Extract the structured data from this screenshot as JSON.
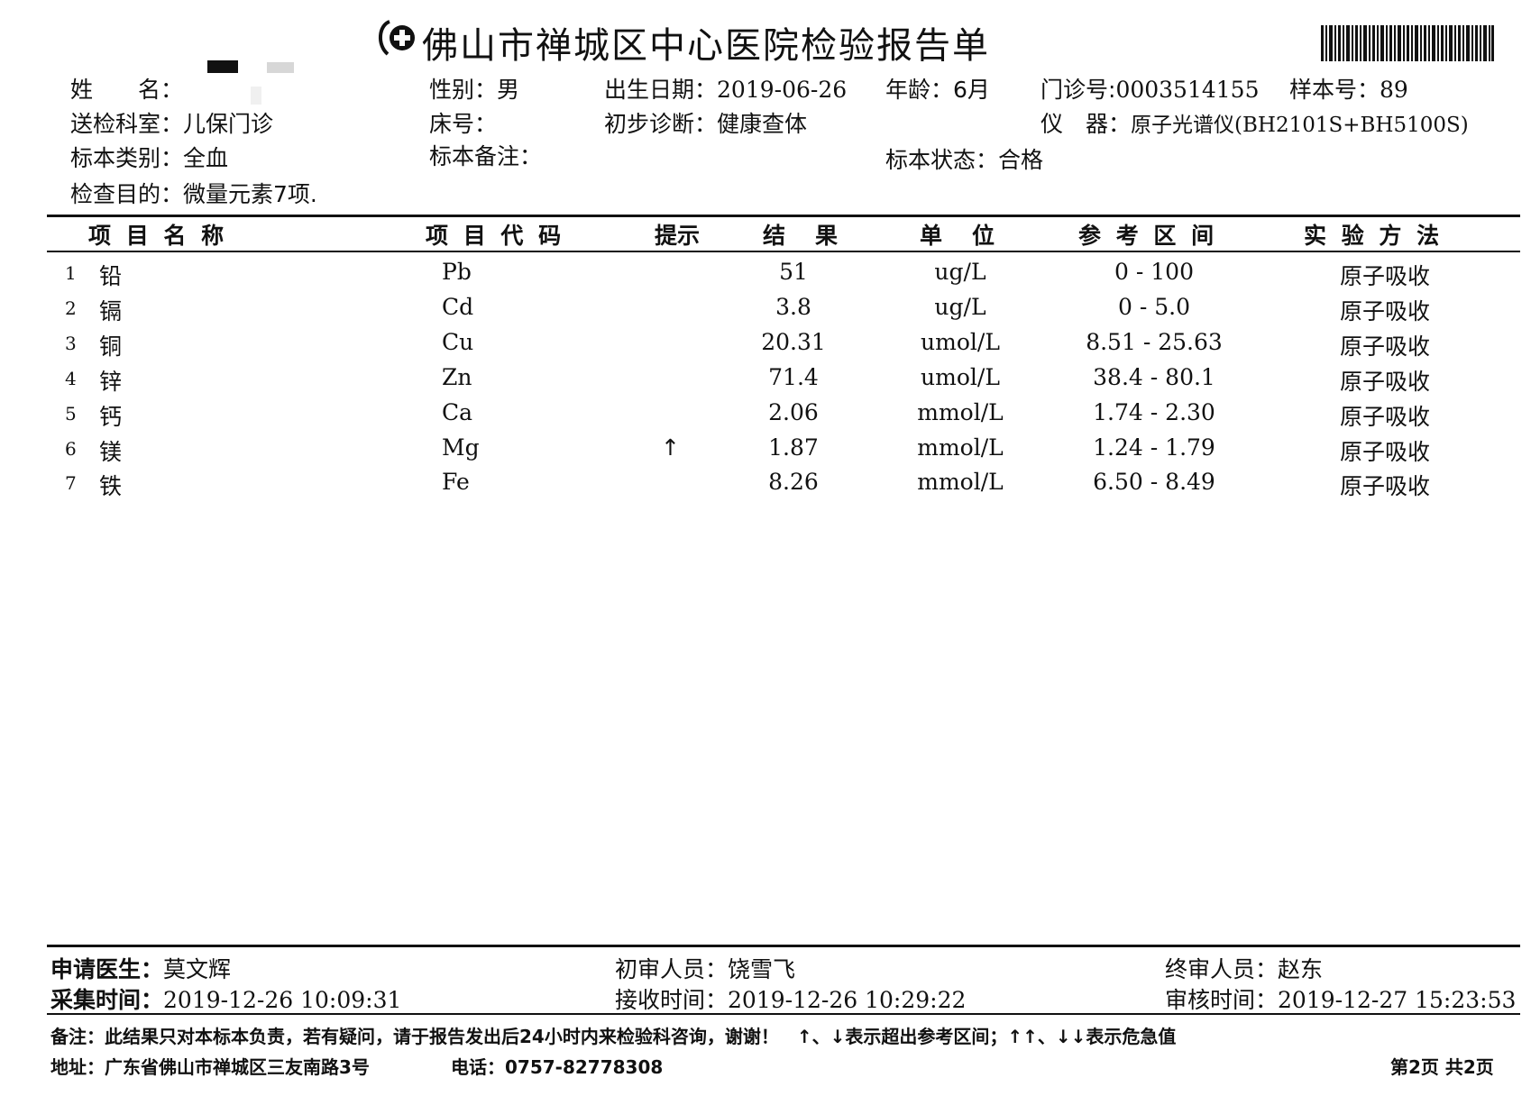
{
  "report": {
    "title": "佛山市禅城区中心医院检验报告单",
    "logo_icon": "hospital-cross-icon",
    "barcode_icon": "barcode-icon"
  },
  "patient": {
    "name_label": "姓　　名：",
    "gender_label": "性别：",
    "gender": "男",
    "birth_label": "出生日期：",
    "birth_date": "2019-06-26",
    "age_label": "年龄：",
    "age": "6月",
    "clinic_label": "门诊号:",
    "clinic_no": "0003514155",
    "sample_label": "样本号：",
    "sample_no": "89",
    "dept_label": "送检科室：",
    "dept": "儿保门诊",
    "bed_label": "床号：",
    "diag_label": "初步诊断：",
    "diagnosis": "健康查体",
    "instrument_label": "仪　器：",
    "instrument": "原子光谱仪(BH2101S+BH5100S)",
    "specimen_type_label": "标本类别：",
    "specimen_type": "全血",
    "specimen_note_label": "标本备注：",
    "specimen_status_label": "标本状态：",
    "specimen_status": "合格",
    "purpose_label": "检查目的：",
    "purpose": "微量元素7项."
  },
  "table": {
    "headers": {
      "name": "项 目 名 称",
      "code": "项 目 代 码",
      "flag": "提示",
      "result": "结　果",
      "unit": "单　位",
      "ref": "参 考 区 间",
      "method": "实 验 方 法"
    },
    "rows": [
      {
        "idx": "1",
        "name": "铅",
        "code": "Pb",
        "flag": "",
        "result": "51",
        "unit": "ug/L",
        "ref": "0 - 100",
        "method": "原子吸收"
      },
      {
        "idx": "2",
        "name": "镉",
        "code": "Cd",
        "flag": "",
        "result": "3.8",
        "unit": "ug/L",
        "ref": "0 - 5.0",
        "method": "原子吸收"
      },
      {
        "idx": "3",
        "name": "铜",
        "code": "Cu",
        "flag": "",
        "result": "20.31",
        "unit": "umol/L",
        "ref": "8.51 - 25.63",
        "method": "原子吸收"
      },
      {
        "idx": "4",
        "name": "锌",
        "code": "Zn",
        "flag": "",
        "result": "71.4",
        "unit": "umol/L",
        "ref": "38.4 - 80.1",
        "method": "原子吸收"
      },
      {
        "idx": "5",
        "name": "钙",
        "code": "Ca",
        "flag": "",
        "result": "2.06",
        "unit": "mmol/L",
        "ref": "1.74 - 2.30",
        "method": "原子吸收"
      },
      {
        "idx": "6",
        "name": "镁",
        "code": "Mg",
        "flag": "↑",
        "result": "1.87",
        "unit": "mmol/L",
        "ref": "1.24 - 1.79",
        "method": "原子吸收"
      },
      {
        "idx": "7",
        "name": "铁",
        "code": "Fe",
        "flag": "",
        "result": "8.26",
        "unit": "mmol/L",
        "ref": "6.50 - 8.49",
        "method": "原子吸收"
      }
    ]
  },
  "footer": {
    "doctor_label": "申请医生：",
    "doctor": "莫文辉",
    "reviewer1_label": "初审人员：",
    "reviewer1": "饶雪飞",
    "reviewer2_label": "终审人员：",
    "reviewer2": "赵东",
    "collect_label": "采集时间：",
    "collect_time": "2019-12-26 10:09:31",
    "receive_label": "接收时间：",
    "receive_time": "2019-12-26 10:29:22",
    "audit_label": "审核时间：",
    "audit_time": "2019-12-27 15:23:53",
    "note": "备注：此结果只对本标本负责，若有疑问，请于报告发出后24小时内来检验科咨询，谢谢！　↑、↓表示超出参考区间；↑↑、↓↓表示危急值",
    "address": "地址：广东省佛山市禅城区三友南路3号",
    "phone": "电话：0757-82778308",
    "page": "第2页 共2页"
  }
}
